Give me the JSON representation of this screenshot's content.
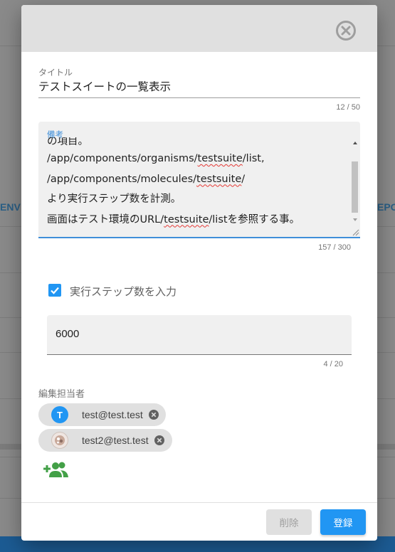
{
  "background": {
    "left_label": "ENV",
    "right_label": "EPO"
  },
  "dialog": {
    "close_icon": "close-circle-icon",
    "title_field": {
      "label": "タイトル",
      "value": "テストスイートの一覧表示",
      "counter": "12 / 50"
    },
    "memo_field": {
      "label": "備考",
      "lines": [
        "の項目。",
        [
          "/app/components/organisms/",
          "testsuite",
          "/list,"
        ],
        [
          "/app/components/molecules/",
          "testsuite",
          "/"
        ],
        "より実行ステップ数を計測。",
        [
          "画面はテスト環境のURL/",
          "testsuite",
          "/listを参照する事。"
        ]
      ],
      "counter": "157 / 300"
    },
    "step_checkbox": {
      "label": "実行ステップ数を入力",
      "checked": true
    },
    "step_field": {
      "value": "6000",
      "counter": "4 / 20"
    },
    "editors": {
      "label": "編集担当者",
      "chips": [
        {
          "email": "test@test.test",
          "avatar_letter": "T",
          "avatar_color": "#2196f3"
        },
        {
          "email": "test2@test.test",
          "avatar_letter": "",
          "avatar_color": "#d7ccc8"
        }
      ],
      "add_icon": "add-user-icon"
    },
    "buttons": {
      "delete": "削除",
      "register": "登録"
    }
  },
  "colors": {
    "accent": "#2196f3",
    "focus": "#3f8fd9",
    "add_user": "#43a047",
    "bottom_bar": "#1c5b93"
  }
}
